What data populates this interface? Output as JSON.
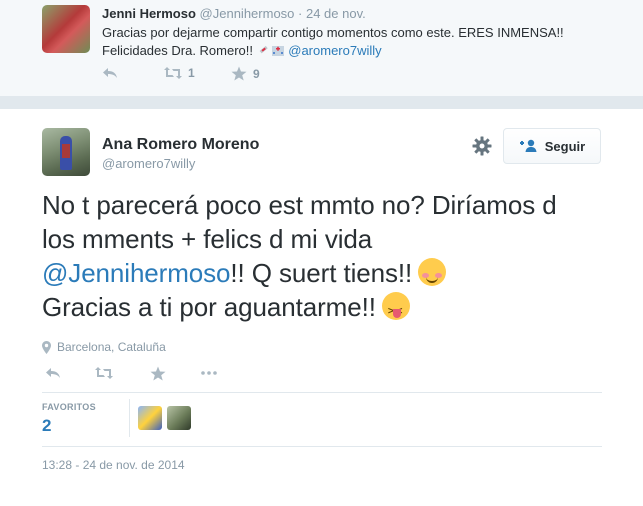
{
  "previous_tweet": {
    "name": "Jenni Hermoso",
    "handle": "@Jennihermoso",
    "time": "· 24 de nov.",
    "text_line1": "Gracias por dejarme compartir contigo momentos como este. ERES INMENSA!!",
    "text_line2_prefix": "Felicidades Dra. Romero!! ",
    "text_line2_mention": "@aromero7willy",
    "retweet_count": "1",
    "favorite_count": "9"
  },
  "main_tweet": {
    "name": "Ana Romero Moreno",
    "handle": "@aromero7willy",
    "follow_label": "Seguir",
    "text_line1": "No t parecerá poco est mmto no? Diríamos d",
    "text_line2": "los mments + felics d mi vida",
    "text_mention": "@Jennihermoso",
    "text_line3_rest": "!! Q suert tiens!!",
    "text_line4": "Gracias a ti por aguantarme!!",
    "location": "Barcelona, Cataluña",
    "favorites_label": "FAVORITOS",
    "favorites_count": "2",
    "timestamp": "13:28 - 24 de nov. de 2014"
  },
  "colors": {
    "link": "#2b7bb9",
    "muted": "#8899a6",
    "text": "#292f33",
    "background": "#e1e8ed"
  },
  "icons": [
    "reply-icon",
    "retweet-icon",
    "favorite-icon",
    "more-icon",
    "gear-icon",
    "follow-person-icon",
    "location-pin-icon",
    "syringe-emoji",
    "hospital-emoji",
    "blush-emoji",
    "tongue-wink-emoji"
  ]
}
